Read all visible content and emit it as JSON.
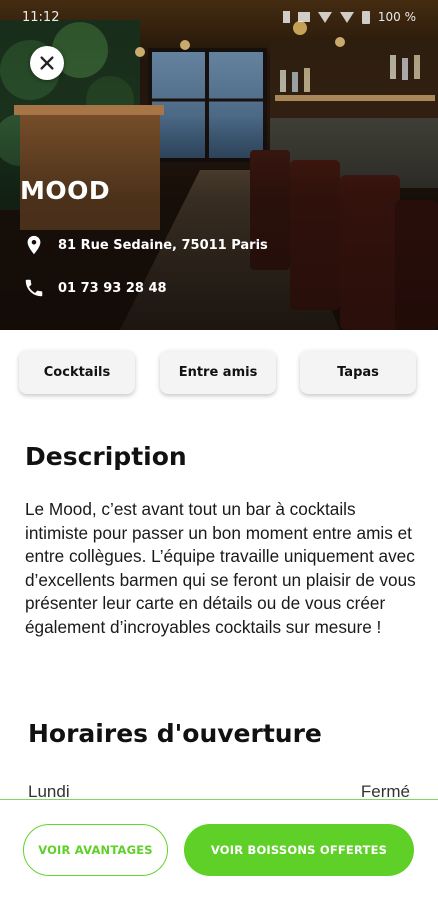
{
  "status_bar": {
    "time": "11:12",
    "battery": "100 %"
  },
  "venue": {
    "name": "MOOD",
    "address": "81 Rue Sedaine, 75011 Paris",
    "phone": "01 73 93 28 48"
  },
  "tags": [
    "Cocktails",
    "Entre amis",
    "Tapas"
  ],
  "description": {
    "title": "Description",
    "body": "Le Mood, c’est avant tout un bar à cocktails intimiste pour passer un bon moment entre amis et entre collègues. L’équipe travaille uniquement avec d’excellents barmen qui se feront un plaisir de vous présenter leur carte en détails ou de vous créer également d’incroyables cocktails sur mesure !"
  },
  "hours": {
    "title": "Horaires d'ouverture",
    "rows": [
      {
        "day": "Lundi",
        "value": "Fermé"
      }
    ]
  },
  "actions": {
    "advantages_label": "VOIR AVANTAGES",
    "drinks_label": "VOIR BOISSONS OFFERTES"
  },
  "colors": {
    "accent": "#5fd028",
    "accent_border": "#7ed957"
  },
  "icons": {
    "close": "close-icon",
    "address": "location-pin-icon",
    "phone": "phone-icon"
  }
}
